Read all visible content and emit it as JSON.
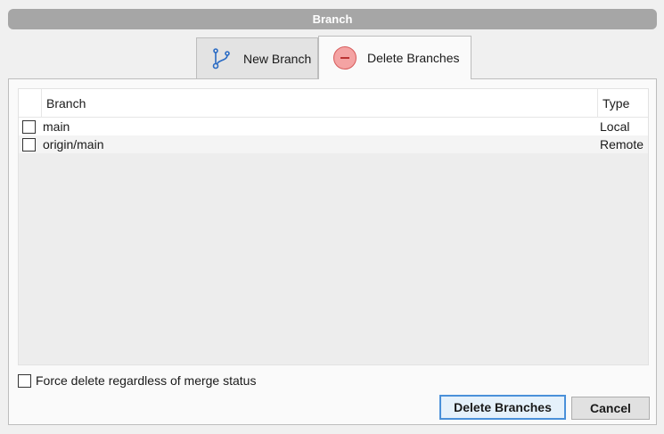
{
  "window": {
    "title": "Branch"
  },
  "tabs": [
    {
      "label": "New Branch",
      "icon": "git-branch-icon",
      "active": false
    },
    {
      "label": "Delete Branches",
      "icon": "minus-circle-icon",
      "active": true
    }
  ],
  "table": {
    "columns": [
      "Branch",
      "Type"
    ],
    "rows": [
      {
        "branch": "main",
        "type": "Local",
        "checked": false
      },
      {
        "branch": "origin/main",
        "type": "Remote",
        "checked": false
      }
    ]
  },
  "options": {
    "force_label": "Force delete regardless of merge status",
    "force_checked": false
  },
  "buttons": {
    "delete_label": "Delete Branches",
    "cancel_label": "Cancel"
  },
  "colors": {
    "accent": "#4a90d9",
    "delete_icon": "#f4a3a3",
    "titlebar": "#a6a6a6"
  }
}
